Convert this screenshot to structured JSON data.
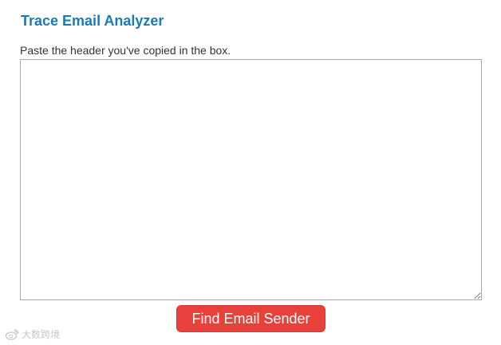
{
  "page": {
    "title": "Trace Email Analyzer",
    "instruction": "Paste the header you've copied in the box."
  },
  "header_input": {
    "value": "",
    "placeholder": ""
  },
  "submit": {
    "label": "Find Email Sender",
    "color": "#e8403a"
  },
  "watermark": {
    "icon": "weibo-icon",
    "text": "大数跨境"
  },
  "colors": {
    "title": "#1a7ab8",
    "text": "#333333"
  }
}
